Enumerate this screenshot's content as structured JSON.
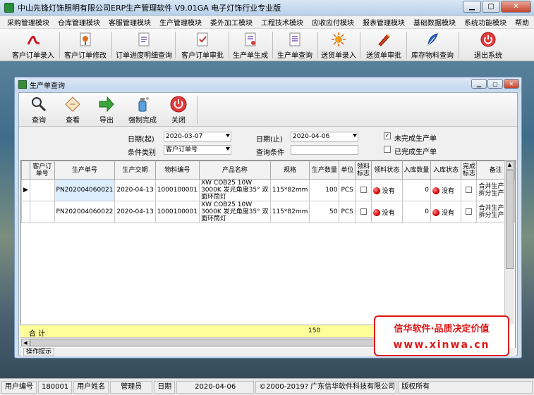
{
  "window": {
    "title": "中山先锋灯饰照明有限公司ERP生产管理软件  V9.01GA 电子灯饰行业专业版"
  },
  "menu": [
    "采购管理模块",
    "仓库管理模块",
    "客服管理模块",
    "生产管理模块",
    "委外加工模块",
    "工程技术模块",
    "应收应付模块",
    "报表管理模块",
    "基础数据模块",
    "系统功能模块",
    "帮助"
  ],
  "toolbar": [
    "客户订单录入",
    "客户订单修改",
    "订单进度明细查询",
    "客户订单审批",
    "生产单生成",
    "生产单查询",
    "送货单录入",
    "送货单审批",
    "库存物料查询",
    "退出系统"
  ],
  "child": {
    "title": "生产单查询",
    "buttons": [
      "查询",
      "查看",
      "导出",
      "强制完成",
      "关闭"
    ],
    "filter": {
      "date_from_label": "日期(起)",
      "date_from": "2020-03-07",
      "date_to_label": "日期(止)",
      "date_to": "2020-04-06",
      "cond_type_label": "条件类别",
      "cond_type": "客户订单号",
      "cond_label": "查询条件",
      "cond_value": "",
      "unfinished_label": "未完成生产单",
      "finished_label": "已完成生产单"
    },
    "columns": [
      "客户订单号",
      "生产单号",
      "生产交期",
      "物料编号",
      "产品名称",
      "规格",
      "生产数量",
      "单位",
      "领料标志",
      "领料状态",
      "入库数量",
      "入库状态",
      "完成标志",
      "备注"
    ],
    "rows": [
      {
        "order": "",
        "pno": "PN202004060021",
        "due": "2020-04-13",
        "mat": "1000100001",
        "name": "XW COB25 10W 3000K 发光角度35° 双面环筒灯",
        "spec": "115*82mm",
        "qty": "100",
        "unit": "PCS",
        "pick_status": "没有",
        "in_qty": "0",
        "in_status": "没有",
        "remark": "合并生产单/拆分生产单"
      },
      {
        "order": "",
        "pno": "PN202004060022",
        "due": "2020-04-13",
        "mat": "1000100001",
        "name": "XW COB25 10W 3000K 发光角度35° 双面环筒灯",
        "spec": "115*82mm",
        "qty": "50",
        "unit": "PCS",
        "pick_status": "没有",
        "in_qty": "0",
        "in_status": "没有",
        "remark": "合并生产单/拆分生产单"
      }
    ],
    "sum_label": "合 计",
    "sum_qty": "150",
    "op_hint": "操作提示"
  },
  "watermark": {
    "line1": "信华软件·品质决定价值",
    "line2": "www.xinwa.cn"
  },
  "status": {
    "user_no_label": "用户编号",
    "user_no": "180001",
    "user_name_label": "用户姓名",
    "user_name": "管理员",
    "date_label": "日期",
    "date": "2020-04-06",
    "copyright": "©2000-2019?  广东信华软件科技有限公司",
    "rights": "版权所有"
  },
  "colors": {
    "sum_row": "#ffff99",
    "status_red": "#d00000",
    "title_bg": "#c3d7ee"
  }
}
